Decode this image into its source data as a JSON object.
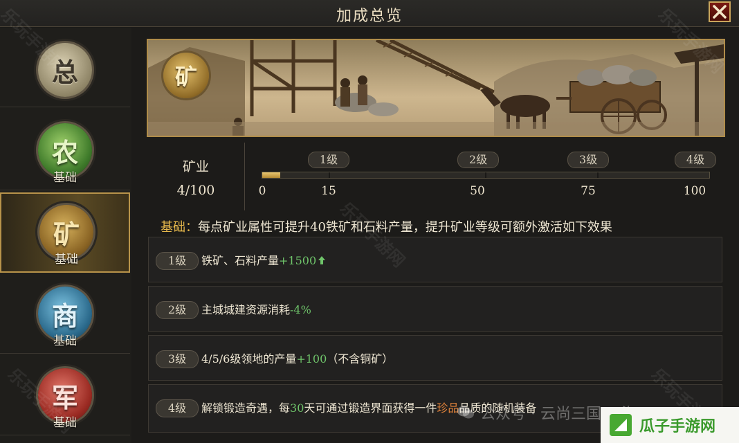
{
  "window": {
    "title": "加成总览"
  },
  "sidebar": {
    "items": [
      {
        "glyph": "总",
        "sub": ""
      },
      {
        "glyph": "农",
        "sub": "基础"
      },
      {
        "glyph": "矿",
        "sub": "基础"
      },
      {
        "glyph": "商",
        "sub": "基础"
      },
      {
        "glyph": "军",
        "sub": "基础"
      }
    ],
    "active_index": 2
  },
  "banner": {
    "emblem": "矿"
  },
  "stat": {
    "name": "矿业",
    "value": "4/100",
    "progress": 4,
    "max": 100,
    "levels": [
      "1级",
      "2级",
      "3级",
      "4级"
    ],
    "ticks": [
      "0",
      "15",
      "50",
      "75",
      "100"
    ]
  },
  "basic": {
    "label": "基础：",
    "text": "每点矿业属性可提升40铁矿和石料产量，提升矿业等级可额外激活如下效果"
  },
  "effects": [
    {
      "level": "1级",
      "pre": "铁矿、石料产量",
      "hl": "+1500",
      "post": ""
    },
    {
      "level": "2级",
      "pre": "主城城建资源消耗",
      "hl": "-4%",
      "post": ""
    },
    {
      "level": "3级",
      "pre": "4/5/6级领地的产量",
      "hl": "+100",
      "post": "（不含铜矿）"
    },
    {
      "level": "4级",
      "pre": "解锁锻造奇遇，每",
      "hl": "30",
      "mid": "天可通过锻造界面获得一件",
      "rare": "珍品",
      "post": "品质的随机装备"
    }
  ],
  "watermarks": {
    "site": "乐玩手游网",
    "wechat": "公众号 · 云尚三国·四海"
  },
  "logo": {
    "text": "瓜子手游网"
  },
  "colors": {
    "accent_gold": "#e6b84c",
    "positive_green": "#6fc46a",
    "rare_orange": "#e0823a"
  }
}
